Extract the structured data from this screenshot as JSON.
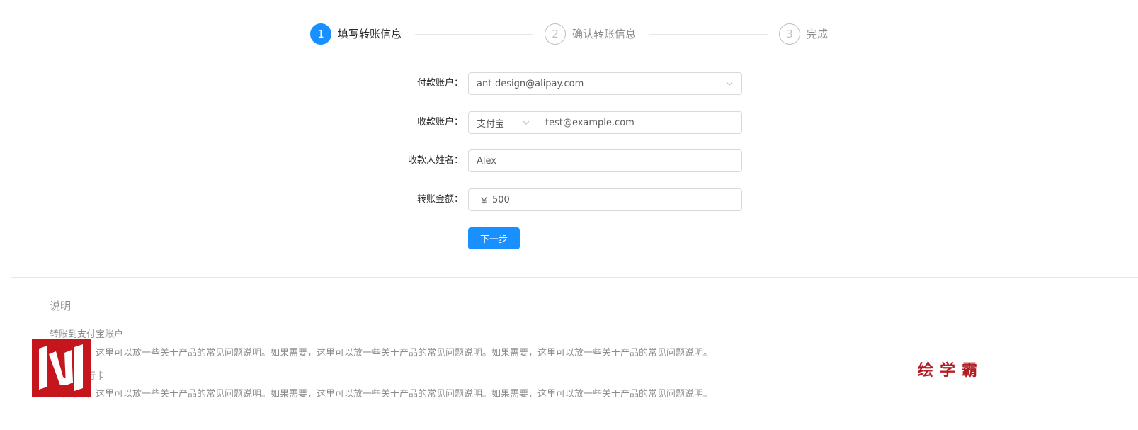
{
  "steps": [
    {
      "index": "1",
      "title": "填写转账信息",
      "status": "active"
    },
    {
      "index": "2",
      "title": "确认转账信息",
      "status": "wait"
    },
    {
      "index": "3",
      "title": "完成",
      "status": "wait"
    }
  ],
  "form": {
    "payer": {
      "label": "付款账户：",
      "value": "ant-design@alipay.com"
    },
    "receiver": {
      "label": "收款账户：",
      "type_value": "支付宝",
      "value": "test@example.com"
    },
    "receiver_name": {
      "label": "收款人姓名：",
      "value": "Alex"
    },
    "amount": {
      "label": "转账金额：",
      "prefix": "￥",
      "value": "500"
    },
    "next_label": "下一步"
  },
  "description": {
    "title": "说明",
    "sections": [
      {
        "heading": "转账到支付宝账户",
        "text": "如果需要，这里可以放一些关于产品的常见问题说明。如果需要，这里可以放一些关于产品的常见问题说明。如果需要，这里可以放一些关于产品的常见问题说明。"
      },
      {
        "heading": "转账到银行卡",
        "text": "如果需要，这里可以放一些关于产品的常见问题说明。如果需要，这里可以放一些关于产品的常见问题说明。如果需要，这里可以放一些关于产品的常见问题说明。"
      }
    ]
  },
  "watermark": {
    "brand": "绘学霸",
    "logo_icon": "w-logo-icon"
  },
  "colors": {
    "primary": "#1890ff",
    "watermark_red": "#c4161c"
  }
}
